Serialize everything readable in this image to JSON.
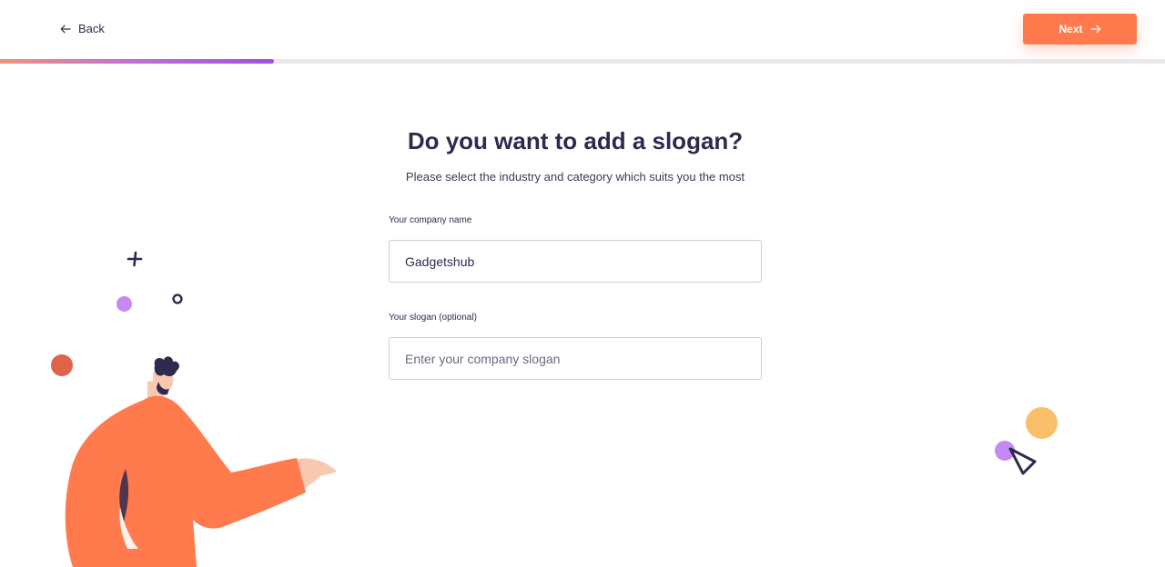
{
  "header": {
    "back_label": "Back",
    "next_label": "Next"
  },
  "progress": {
    "fraction": 0.235,
    "gradient_start": "#f0937a",
    "gradient_end": "#a24fe0"
  },
  "main": {
    "title": "Do you want to add a slogan?",
    "subtitle": "Please select the industry and category which suits you the most",
    "company_field": {
      "label": "Your company name",
      "value": "Gadgetshub"
    },
    "slogan_field": {
      "label": "Your slogan (optional)",
      "value": "",
      "placeholder": "Enter your company slogan"
    }
  },
  "colors": {
    "accent": "#ff7a4d",
    "text": "#2e2a4f",
    "purple": "#c58af1",
    "coral": "#e0624a",
    "yellow": "#fbbf6b"
  },
  "icons": {
    "back": "arrow-left-icon",
    "next": "arrow-right-icon"
  }
}
